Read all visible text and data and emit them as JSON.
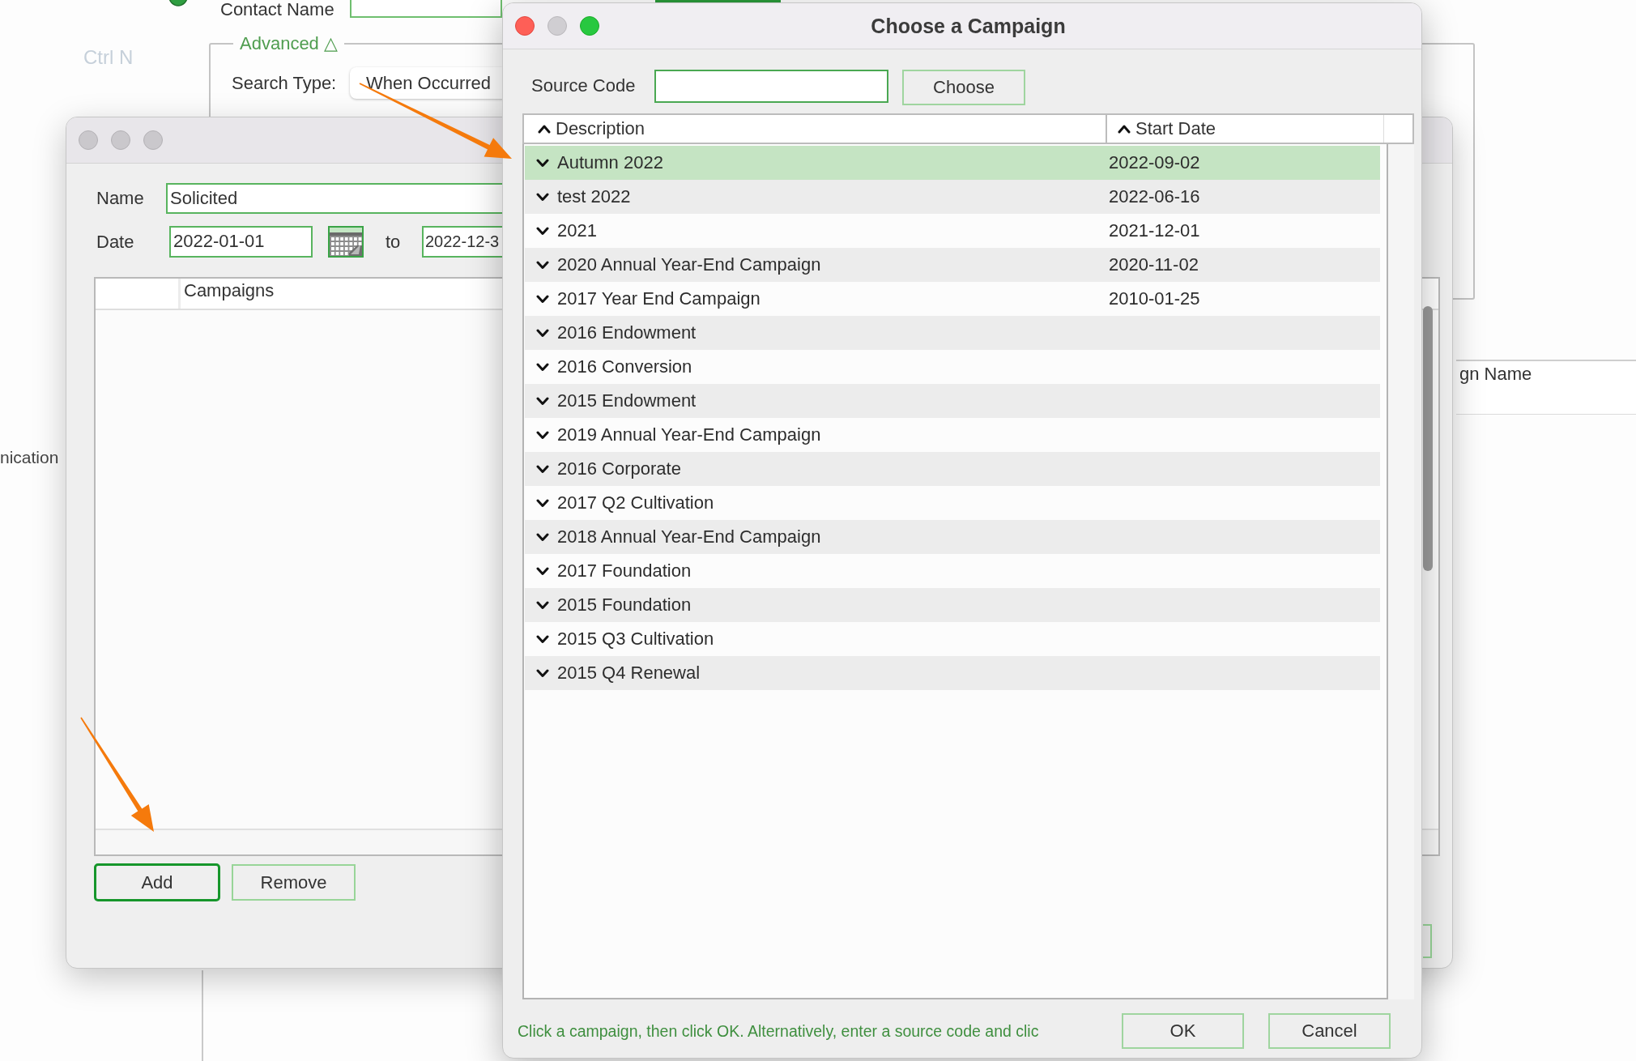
{
  "main_window": {
    "contact_name_label": "Contact Name",
    "shortcut": "Ctrl N",
    "advanced": {
      "title": "Advanced",
      "toggle": "△"
    },
    "search_type_label": "Search Type:",
    "search_type_value": "When Occurred",
    "side_label": "nication",
    "column_header": "gn Name"
  },
  "filter_dialog": {
    "active": false,
    "name_label": "Name",
    "name_value": "Solicited",
    "date_label": "Date",
    "date_from": "2022-01-01",
    "to_label": "to",
    "date_to": "2022-12-3",
    "table": {
      "column_2": "Campaigns"
    },
    "buttons": [
      {
        "label": "Add",
        "focused": true
      },
      {
        "label": "Remove",
        "focused": false
      }
    ]
  },
  "campaign_dialog": {
    "active": true,
    "title": "Choose a Campaign",
    "source_code_label": "Source Code",
    "choose_button": "Choose",
    "table": {
      "columns": [
        {
          "label": "Description",
          "sort_ascending": true
        },
        {
          "label": "Start Date",
          "sort_ascending": true
        }
      ],
      "rows": [
        {
          "description": "Autumn 2022",
          "start_date": "2022-09-02",
          "selected": true
        },
        {
          "description": "test 2022",
          "start_date": "2022-06-16",
          "selected": false
        },
        {
          "description": "2021",
          "start_date": "2021-12-01",
          "selected": false
        },
        {
          "description": "2020 Annual Year-End Campaign",
          "start_date": "2020-11-02",
          "selected": false
        },
        {
          "description": "2017 Year End Campaign",
          "start_date": "2010-01-25",
          "selected": false
        },
        {
          "description": "2016 Endowment",
          "selected": false
        },
        {
          "description": "2016 Conversion",
          "selected": false
        },
        {
          "description": "2015 Endowment",
          "selected": false
        },
        {
          "description": "2019 Annual Year-End Campaign",
          "selected": false
        },
        {
          "description": "2016 Corporate",
          "selected": false
        },
        {
          "description": "2017 Q2 Cultivation",
          "selected": false
        },
        {
          "description": "2018 Annual Year-End Campaign",
          "selected": false
        },
        {
          "description": "2017 Foundation",
          "selected": false
        },
        {
          "description": "2015 Foundation",
          "selected": false
        },
        {
          "description": "2015 Q3 Cultivation",
          "selected": false
        },
        {
          "description": "2015 Q4 Renewal",
          "selected": false
        }
      ]
    },
    "hint": "Click a campaign, then click OK. Alternatively, enter a source code and clic",
    "buttons": [
      "OK",
      "Cancel"
    ]
  }
}
